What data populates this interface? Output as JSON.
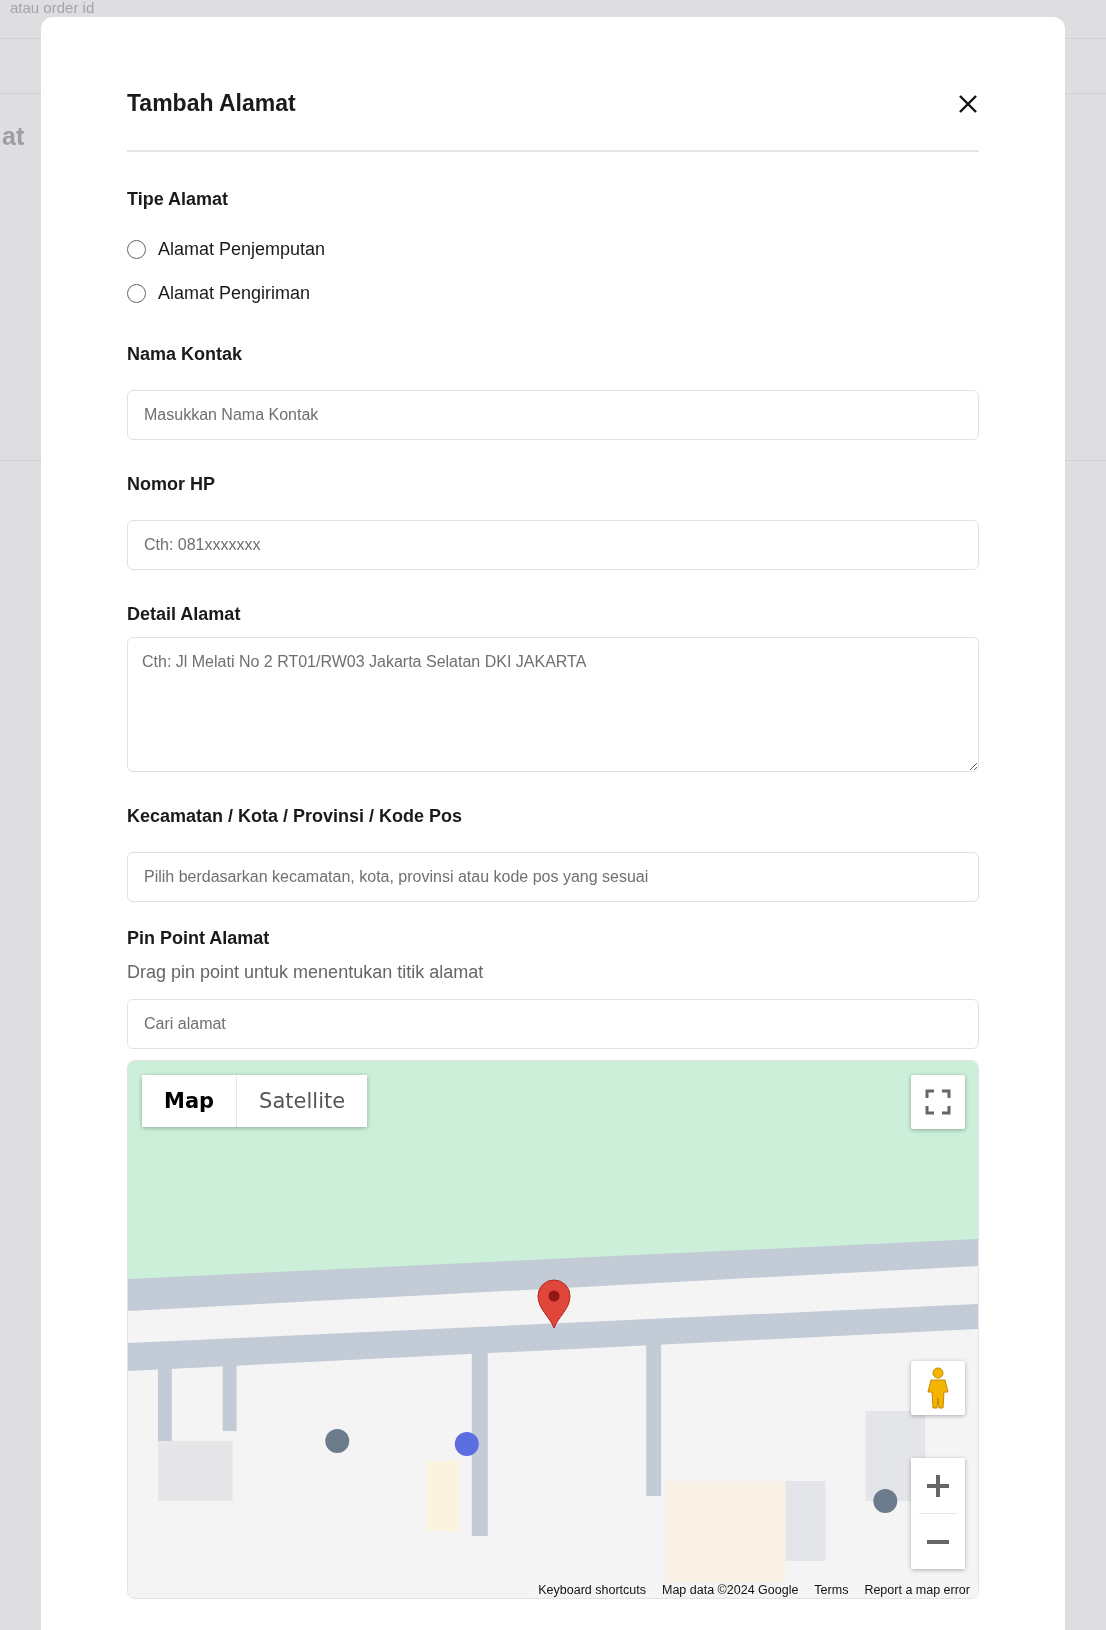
{
  "background": {
    "search_placeholder": "atau order id",
    "heading": "at"
  },
  "dialog": {
    "title": "Tambah Alamat"
  },
  "address_type": {
    "label": "Tipe Alamat",
    "options": [
      {
        "label": "Alamat Penjemputan",
        "selected": false
      },
      {
        "label": "Alamat Pengiriman",
        "selected": false
      }
    ]
  },
  "fields": [
    {
      "kind": "input",
      "label": "Nama Kontak",
      "placeholder": "Masukkan Nama Kontak"
    },
    {
      "kind": "input",
      "label": "Nomor HP",
      "placeholder": "Cth: 081xxxxxxx"
    },
    {
      "kind": "textarea",
      "label": "Detail Alamat",
      "placeholder": "Cth: Jl Melati No 2 RT01/RW03 Jakarta Selatan DKI JAKARTA"
    },
    {
      "kind": "input",
      "label": "Kecamatan / Kota / Provinsi / Kode Pos",
      "placeholder": "Pilih berdasarkan kecamatan, kota, provinsi atau kode pos yang sesuai"
    }
  ],
  "pin_point": {
    "label": "Pin Point Alamat",
    "hint": "Drag pin point untuk menentukan titik alamat",
    "search_placeholder": "Cari alamat"
  },
  "map": {
    "kind": "picture",
    "map_types": [
      {
        "label": "Map",
        "selected": true
      },
      {
        "label": "Satellite",
        "selected": false
      }
    ],
    "footer": [
      "Keyboard shortcuts",
      "Map data ©2024 Google",
      "Terms",
      "Report a map error"
    ]
  }
}
